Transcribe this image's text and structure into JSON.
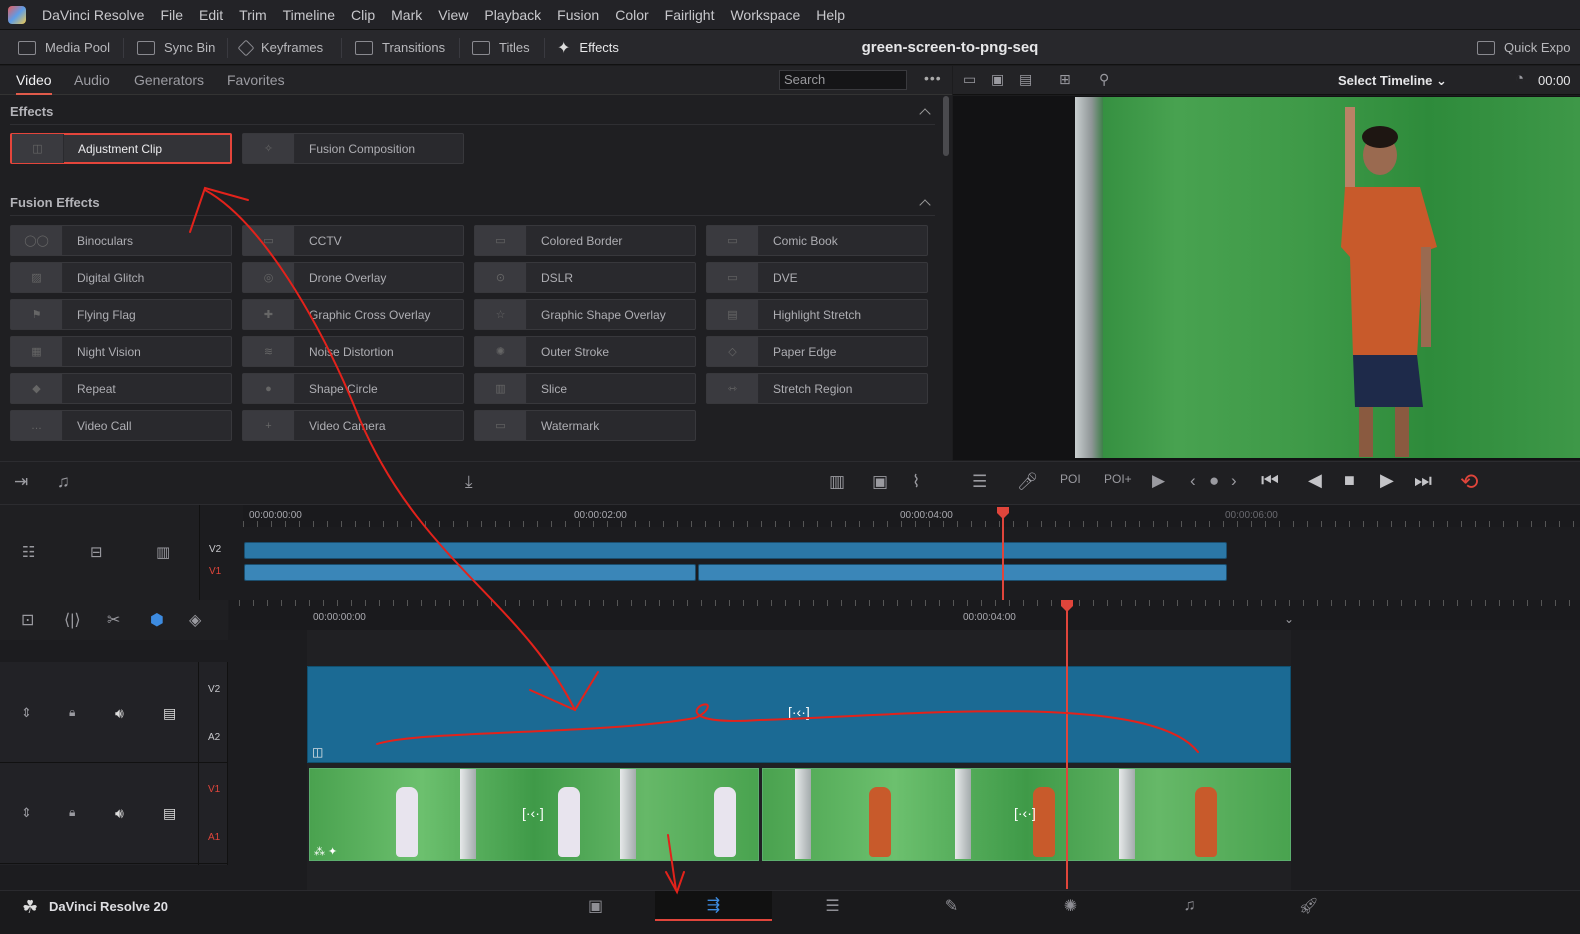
{
  "app": {
    "menu": [
      "DaVinci Resolve",
      "File",
      "Edit",
      "Trim",
      "Timeline",
      "Clip",
      "Mark",
      "View",
      "Playback",
      "Fusion",
      "Color",
      "Fairlight",
      "Workspace",
      "Help"
    ]
  },
  "toolbar": {
    "buttons": [
      "Media Pool",
      "Sync Bin",
      "Keyframes",
      "Transitions",
      "Titles",
      "Effects"
    ],
    "project_title": "green-screen-to-png-seq",
    "quick_export": "Quick Expo"
  },
  "effects_panel": {
    "tabs": [
      "Video",
      "Audio",
      "Generators",
      "Favorites"
    ],
    "search_placeholder": "Search",
    "sections": [
      {
        "title": "Effects",
        "items": [
          "Adjustment Clip",
          "Fusion Composition"
        ]
      },
      {
        "title": "Fusion Effects",
        "items": [
          "Binoculars",
          "CCTV",
          "Colored Border",
          "Comic Book",
          "Digital Glitch",
          "Drone Overlay",
          "DSLR",
          "DVE",
          "Flying Flag",
          "Graphic Cross Overlay",
          "Graphic Shape Overlay",
          "Highlight Stretch",
          "Night Vision",
          "Noise Distortion",
          "Outer Stroke",
          "Paper Edge",
          "Repeat",
          "Shape Circle",
          "Slice",
          "Stretch Region",
          "Video Call",
          "Video Camera",
          "Watermark"
        ]
      }
    ],
    "selected_item": "Adjustment Clip"
  },
  "viewer": {
    "timeline_select": "Select Timeline",
    "timecode": "00:00"
  },
  "upper_timeline": {
    "timecodes": [
      "00:00:00:00",
      "00:00:02:00",
      "00:00:04:00",
      "00:00:06:00"
    ],
    "tracks": [
      "V2",
      "V1"
    ]
  },
  "lower_timeline": {
    "timecodes": [
      "00:00:00:00",
      "00:00:04:00"
    ],
    "tracks": [
      {
        "video": "V2",
        "audio": "A2"
      },
      {
        "video": "V1",
        "audio": "A1"
      }
    ],
    "clip_marker": "[·‹·]"
  },
  "footer": {
    "brand": "DaVinci Resolve 20",
    "active_page": "cut"
  },
  "colors": {
    "accent_red": "#e0453b",
    "clip_blue": "#2b77a6",
    "annotation_red": "#e3221b"
  }
}
